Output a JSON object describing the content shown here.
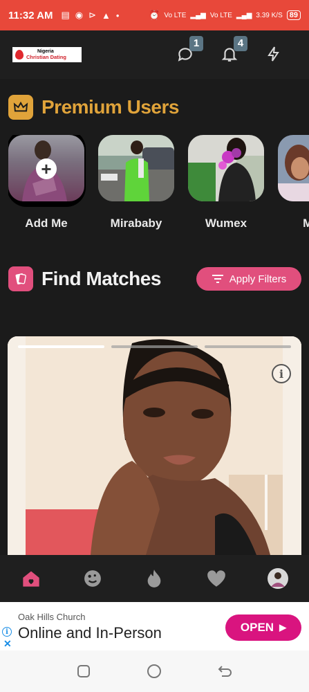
{
  "status_bar": {
    "time": "11:32 AM",
    "net1": "Vo LTE",
    "net2": "Vo LTE",
    "speed": "3.39 K/S",
    "battery": "89"
  },
  "header": {
    "logo_line1": "Nigeria",
    "logo_line2": "Christian Dating",
    "messages_badge": "1",
    "notifications_badge": "4"
  },
  "premium": {
    "title": "Premium Users",
    "users": [
      {
        "name": "Add Me"
      },
      {
        "name": "Mirababy"
      },
      {
        "name": "Wumex"
      },
      {
        "name": "Mhiz"
      }
    ]
  },
  "matches": {
    "title": "Find Matches",
    "filter_label": "Apply Filters",
    "photo_count": 3,
    "active_photo": 1
  },
  "ad": {
    "advertiser": "Oak Hills Church",
    "headline": "Online and In-Person",
    "cta": "OPEN"
  },
  "colors": {
    "status_bar": "#e8483a",
    "background": "#1b1b1b",
    "premium_accent": "#e0a33a",
    "matches_accent": "#e14f7d",
    "ad_cta": "#d9147f"
  }
}
